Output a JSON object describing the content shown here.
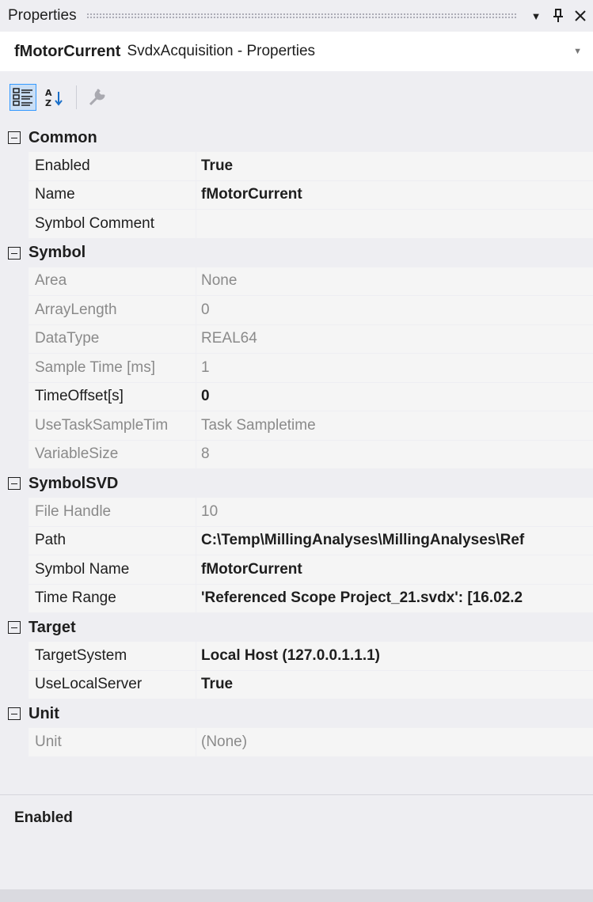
{
  "window": {
    "title": "Properties",
    "buttons": [
      {
        "name": "dropdown-arrow-icon",
        "glyph": "▼"
      },
      {
        "name": "pin-icon",
        "glyph": "ᛘ"
      },
      {
        "name": "close-icon",
        "glyph": "✕"
      }
    ]
  },
  "object_selector": {
    "name": "fMotorCurrent",
    "type": "SvdxAcquisition - Properties"
  },
  "toolbar": {
    "items": [
      "categorized-view-icon",
      "alphabetical-sort-icon",
      "property-pages-wrench-icon"
    ]
  },
  "categories": [
    {
      "name": "Common",
      "properties": [
        {
          "name": "Enabled",
          "value": "True",
          "bold": true,
          "readonly": false
        },
        {
          "name": "Name",
          "value": "fMotorCurrent",
          "bold": true,
          "readonly": false
        },
        {
          "name": "Symbol Comment",
          "value": "",
          "bold": false,
          "readonly": false
        }
      ]
    },
    {
      "name": "Symbol",
      "properties": [
        {
          "name": "Area",
          "value": "None",
          "bold": false,
          "readonly": true
        },
        {
          "name": "ArrayLength",
          "value": "0",
          "bold": false,
          "readonly": true
        },
        {
          "name": "DataType",
          "value": "REAL64",
          "bold": false,
          "readonly": true
        },
        {
          "name": "Sample Time [ms]",
          "value": "1",
          "bold": false,
          "readonly": true
        },
        {
          "name": "TimeOffset[s]",
          "value": "0",
          "bold": true,
          "readonly": false
        },
        {
          "name": "UseTaskSampleTim",
          "value": "Task Sampletime",
          "bold": false,
          "readonly": true
        },
        {
          "name": "VariableSize",
          "value": "8",
          "bold": false,
          "readonly": true
        }
      ]
    },
    {
      "name": "SymbolSVD",
      "properties": [
        {
          "name": "File Handle",
          "value": "10",
          "bold": false,
          "readonly": true
        },
        {
          "name": "Path",
          "value": "C:\\Temp\\MillingAnalyses\\MillingAnalyses\\Ref",
          "bold": true,
          "readonly": false
        },
        {
          "name": "Symbol Name",
          "value": "fMotorCurrent",
          "bold": true,
          "readonly": false
        },
        {
          "name": "Time Range",
          "value": "'Referenced Scope Project_21.svdx': [16.02.2",
          "bold": true,
          "readonly": false
        }
      ]
    },
    {
      "name": "Target",
      "properties": [
        {
          "name": "TargetSystem",
          "value": "Local Host (127.0.0.1.1.1)",
          "bold": true,
          "readonly": false
        },
        {
          "name": "UseLocalServer",
          "value": "True",
          "bold": true,
          "readonly": false
        }
      ]
    },
    {
      "name": "Unit",
      "properties": [
        {
          "name": "Unit",
          "value": "(None)",
          "bold": false,
          "readonly": true
        }
      ]
    }
  ],
  "description": {
    "title": "Enabled"
  }
}
